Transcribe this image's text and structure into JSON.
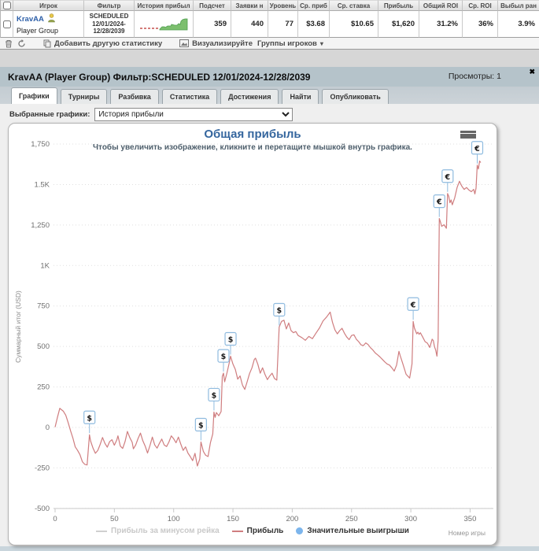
{
  "table": {
    "headers": [
      "",
      "Игрок",
      "Фильтр",
      "История прибыл",
      "Подсчет",
      "Заявки н",
      "Уровень",
      "Ср. приб",
      "Ср. ставка",
      "Прибыль",
      "Общий ROI",
      "Ср. ROI",
      "Выбыл ран"
    ],
    "row": {
      "player": "KravAA",
      "group": "Player Group",
      "filter_line1": "SCHEDULED",
      "filter_line2": "12/01/2024-",
      "filter_line3": "12/28/2039",
      "count": "359",
      "entries": "440",
      "level": "77",
      "avg_profit": "$3.68",
      "avg_stake": "$10.65",
      "profit": "$1,620",
      "total_roi": "31.2%",
      "avg_roi": "36%",
      "early_bust": "3.9%"
    }
  },
  "toolbar": {
    "add_stat": "Добавить другую статистику",
    "visualize": "Визуализируйте",
    "player_groups": "Группы игроков",
    "chevron": "▾"
  },
  "panel": {
    "title": "KravAA (Player Group) Фильтр:SCHEDULED 12/01/2024-12/28/2039",
    "views": "Просмотры: 1",
    "close": "✖"
  },
  "tabs": [
    {
      "label": "Графики"
    },
    {
      "label": "Турниры"
    },
    {
      "label": "Разбивка"
    },
    {
      "label": "Статистика"
    },
    {
      "label": "Достижения"
    },
    {
      "label": "Найти"
    },
    {
      "label": "Опубликовать"
    }
  ],
  "graph_select": {
    "label": "Выбранные графики:",
    "value": "История прибыли"
  },
  "chart_data": {
    "type": "line",
    "title": "Общая прибыль",
    "subtitle": "Чтобы увеличить изображение, кликните и перетащите мышкой внутрь графика.",
    "xlabel": "Номер игры",
    "ylabel": "Суммарный итог (USD)",
    "xlim": [
      0,
      370
    ],
    "ylim": [
      -500,
      1750
    ],
    "grid": true,
    "legend_position": "bottom",
    "x_ticks": [
      0,
      50,
      100,
      150,
      200,
      250,
      300,
      350
    ],
    "y_ticks": [
      {
        "label": "1,750",
        "value": 1750
      },
      {
        "label": "1.5K",
        "value": 1500
      },
      {
        "label": "1,250",
        "value": 1250
      },
      {
        "label": "1K",
        "value": 1000
      },
      {
        "label": "750",
        "value": 750
      },
      {
        "label": "500",
        "value": 500
      },
      {
        "label": "250",
        "value": 250
      },
      {
        "label": "0",
        "value": 0
      },
      {
        "label": "-250",
        "value": -250
      },
      {
        "label": "-500",
        "value": -500
      }
    ],
    "legend": [
      {
        "label": "Прибыль за минусом рейка",
        "color": "#cfcfcf",
        "enabled": false
      },
      {
        "label": "Прибыль",
        "color": "#cf7d7f",
        "enabled": true
      },
      {
        "label": "Значительные выигрыши",
        "color": "#7cb5ec",
        "enabled": true
      }
    ],
    "marker_color": "#8fbbdf",
    "series": [
      {
        "name": "Прибыль",
        "color": "#cf7d7f",
        "points": [
          [
            0,
            2
          ],
          [
            2,
            62
          ],
          [
            4,
            118
          ],
          [
            5,
            112
          ],
          [
            7,
            100
          ],
          [
            9,
            75
          ],
          [
            11,
            30
          ],
          [
            13,
            -20
          ],
          [
            15,
            -65
          ],
          [
            17,
            -120
          ],
          [
            19,
            -142
          ],
          [
            21,
            -168
          ],
          [
            23,
            -212
          ],
          [
            25,
            -228
          ],
          [
            27,
            -232
          ],
          [
            29,
            -45
          ],
          [
            30,
            -85
          ],
          [
            32,
            -128
          ],
          [
            34,
            -160
          ],
          [
            36,
            -142
          ],
          [
            38,
            -105
          ],
          [
            40,
            -62
          ],
          [
            42,
            -98
          ],
          [
            44,
            -122
          ],
          [
            46,
            -88
          ],
          [
            48,
            -76
          ],
          [
            50,
            -110
          ],
          [
            52,
            -78
          ],
          [
            53,
            -52
          ],
          [
            55,
            -115
          ],
          [
            57,
            -130
          ],
          [
            59,
            -88
          ],
          [
            61,
            -25
          ],
          [
            63,
            -62
          ],
          [
            65,
            -92
          ],
          [
            66,
            -132
          ],
          [
            68,
            -108
          ],
          [
            70,
            -68
          ],
          [
            72,
            -35
          ],
          [
            74,
            -82
          ],
          [
            76,
            -115
          ],
          [
            78,
            -158
          ],
          [
            80,
            -112
          ],
          [
            82,
            -60
          ],
          [
            84,
            -108
          ],
          [
            86,
            -128
          ],
          [
            88,
            -98
          ],
          [
            90,
            -72
          ],
          [
            92,
            -108
          ],
          [
            94,
            -118
          ],
          [
            96,
            -90
          ],
          [
            98,
            -52
          ],
          [
            100,
            -70
          ],
          [
            102,
            -95
          ],
          [
            104,
            -60
          ],
          [
            106,
            -102
          ],
          [
            108,
            -142
          ],
          [
            110,
            -120
          ],
          [
            112,
            -158
          ],
          [
            114,
            -180
          ],
          [
            116,
            -205
          ],
          [
            118,
            -160
          ],
          [
            120,
            -238
          ],
          [
            122,
            -195
          ],
          [
            123,
            -90
          ],
          [
            125,
            -148
          ],
          [
            127,
            -172
          ],
          [
            129,
            -180
          ],
          [
            131,
            -95
          ],
          [
            133,
            -40
          ],
          [
            134,
            95
          ],
          [
            135,
            62
          ],
          [
            136,
            92
          ],
          [
            138,
            72
          ],
          [
            140,
            98
          ],
          [
            141,
            315
          ],
          [
            142,
            335
          ],
          [
            143,
            282
          ],
          [
            145,
            338
          ],
          [
            147,
            402
          ],
          [
            148,
            440
          ],
          [
            150,
            392
          ],
          [
            152,
            358
          ],
          [
            154,
            298
          ],
          [
            156,
            318
          ],
          [
            158,
            262
          ],
          [
            160,
            235
          ],
          [
            162,
            282
          ],
          [
            164,
            332
          ],
          [
            166,
            368
          ],
          [
            168,
            420
          ],
          [
            169,
            428
          ],
          [
            171,
            390
          ],
          [
            173,
            335
          ],
          [
            175,
            368
          ],
          [
            177,
            328
          ],
          [
            179,
            295
          ],
          [
            181,
            318
          ],
          [
            183,
            335
          ],
          [
            185,
            302
          ],
          [
            187,
            292
          ],
          [
            189,
            620
          ],
          [
            191,
            655
          ],
          [
            193,
            662
          ],
          [
            195,
            608
          ],
          [
            197,
            645
          ],
          [
            199,
            598
          ],
          [
            201,
            585
          ],
          [
            203,
            592
          ],
          [
            205,
            568
          ],
          [
            208,
            555
          ],
          [
            211,
            538
          ],
          [
            214,
            562
          ],
          [
            217,
            548
          ],
          [
            220,
            582
          ],
          [
            223,
            615
          ],
          [
            226,
            658
          ],
          [
            229,
            682
          ],
          [
            232,
            712
          ],
          [
            234,
            648
          ],
          [
            236,
            602
          ],
          [
            238,
            578
          ],
          [
            240,
            598
          ],
          [
            242,
            612
          ],
          [
            244,
            582
          ],
          [
            246,
            558
          ],
          [
            248,
            542
          ],
          [
            250,
            568
          ],
          [
            252,
            572
          ],
          [
            254,
            545
          ],
          [
            256,
            530
          ],
          [
            258,
            510
          ],
          [
            260,
            505
          ],
          [
            262,
            522
          ],
          [
            264,
            512
          ],
          [
            266,
            492
          ],
          [
            268,
            478
          ],
          [
            270,
            460
          ],
          [
            272,
            448
          ],
          [
            274,
            435
          ],
          [
            276,
            420
          ],
          [
            278,
            405
          ],
          [
            280,
            392
          ],
          [
            282,
            385
          ],
          [
            284,
            368
          ],
          [
            286,
            348
          ],
          [
            288,
            385
          ],
          [
            290,
            470
          ],
          [
            291,
            445
          ],
          [
            293,
            398
          ],
          [
            296,
            328
          ],
          [
            299,
            305
          ],
          [
            301,
            392
          ],
          [
            302,
            655
          ],
          [
            303,
            615
          ],
          [
            305,
            578
          ],
          [
            306,
            588
          ],
          [
            307,
            575
          ],
          [
            308,
            585
          ],
          [
            310,
            558
          ],
          [
            312,
            530
          ],
          [
            314,
            520
          ],
          [
            316,
            494
          ],
          [
            318,
            545
          ],
          [
            319,
            536
          ],
          [
            320,
            498
          ],
          [
            321,
            478
          ],
          [
            322,
            440
          ],
          [
            323,
            538
          ],
          [
            324,
            1290
          ],
          [
            325,
            1268
          ],
          [
            326,
            1242
          ],
          [
            328,
            1252
          ],
          [
            330,
            1230
          ],
          [
            331,
            1445
          ],
          [
            332,
            1428
          ],
          [
            333,
            1388
          ],
          [
            334,
            1405
          ],
          [
            335,
            1375
          ],
          [
            337,
            1418
          ],
          [
            339,
            1482
          ],
          [
            341,
            1520
          ],
          [
            343,
            1490
          ],
          [
            345,
            1470
          ],
          [
            347,
            1482
          ],
          [
            349,
            1466
          ],
          [
            351,
            1456
          ],
          [
            353,
            1470
          ],
          [
            354,
            1442
          ],
          [
            355,
            1478
          ],
          [
            356,
            1620
          ],
          [
            357,
            1596
          ],
          [
            358,
            1645
          ],
          [
            359,
            1636
          ]
        ]
      }
    ],
    "markers": [
      {
        "x": 29,
        "y": -45,
        "symbol": "$"
      },
      {
        "x": 123,
        "y": -90,
        "symbol": "$"
      },
      {
        "x": 134,
        "y": 95,
        "symbol": "$"
      },
      {
        "x": 142,
        "y": 335,
        "symbol": "$"
      },
      {
        "x": 148,
        "y": 440,
        "symbol": "$"
      },
      {
        "x": 189,
        "y": 620,
        "symbol": "$"
      },
      {
        "x": 302,
        "y": 655,
        "symbol": "€"
      },
      {
        "x": 324,
        "y": 1290,
        "symbol": "€"
      },
      {
        "x": 331,
        "y": 1445,
        "symbol": "€"
      },
      {
        "x": 356,
        "y": 1620,
        "symbol": "€"
      }
    ]
  }
}
